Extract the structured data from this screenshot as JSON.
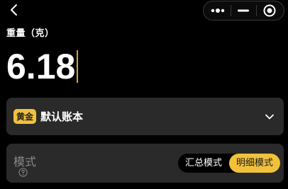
{
  "header": {
    "back_icon": "chevron-left-icon",
    "capsule_icons": [
      "more-dots-icon",
      "minimize-icon",
      "record-target-icon"
    ]
  },
  "weight": {
    "label": "重量（克）",
    "value": "6.18"
  },
  "account": {
    "badge": "黄金",
    "name": "默认账本",
    "dropdown_icon": "chevron-down-icon"
  },
  "mode": {
    "label": "模式",
    "help_icon": "question-circle-icon",
    "options": [
      "汇总模式",
      "明细模式"
    ],
    "selected": "明细模式"
  },
  "colors": {
    "accent": "#f2c13c",
    "background": "#000000",
    "card": "#2a2a2a",
    "cursor": "#d4a33b"
  }
}
